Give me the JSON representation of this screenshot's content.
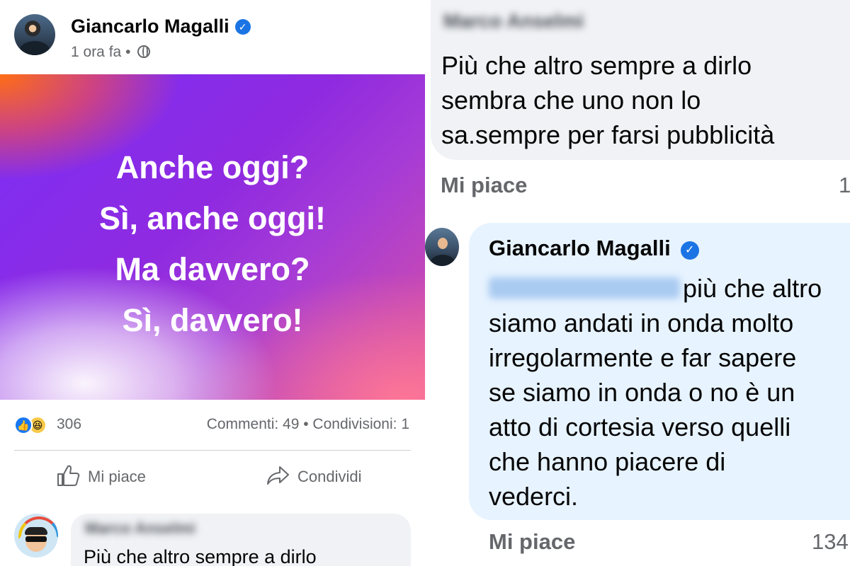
{
  "left_post": {
    "author": "Giancarlo Magalli",
    "time": "1 ora fa",
    "separator": "•",
    "image_lines": [
      "Anche oggi?",
      "Sì, anche oggi!",
      "Ma davvero?",
      "Sì, davvero!"
    ],
    "reaction_count": "306",
    "engagement": "Commenti: 49 • Condivisioni: 1",
    "actions": {
      "like": "Mi piace",
      "share": "Condividi"
    },
    "comment": {
      "author_blurred": "Marco Anselmi",
      "text": "Più che altro sempre a dirlo"
    }
  },
  "right_thread": {
    "comment": {
      "author_blurred": "Marco Anselmi",
      "lines": [
        "Più che altro sempre a dirlo",
        "sembra che uno non lo",
        "sa.sempre per farsi  pubblicità"
      ],
      "like_label": "Mi piace",
      "count": "1"
    },
    "reply": {
      "author": "Giancarlo Magalli",
      "first_line": "più che altro",
      "lines": [
        "siamo andati in onda molto",
        "irregolarmente e far sapere",
        "se siamo in onda o no è un",
        "atto di cortesia verso quelli",
        "che hanno piacere di",
        "vederci."
      ],
      "like_label": "Mi piace",
      "count": "134"
    }
  },
  "colors": {
    "verified_blue": "#1b74e4",
    "reply_bubble": "#e7f3ff",
    "comment_bubble": "#f0f2f5",
    "muted_text": "#65676b"
  }
}
